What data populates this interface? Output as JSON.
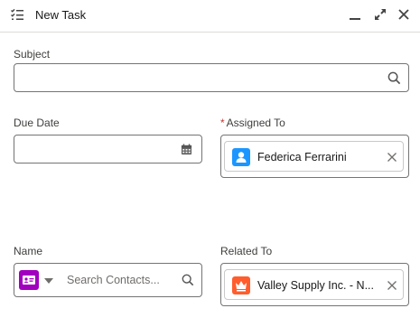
{
  "header": {
    "title": "New Task",
    "task_icon": "task-list-icon",
    "minimize_icon": "minimize-icon",
    "expand_icon": "expand-icon",
    "close_icon": "close-icon"
  },
  "form": {
    "subject": {
      "label": "Subject",
      "value": "",
      "icon": "search-icon"
    },
    "due_date": {
      "label": "Due Date",
      "value": "",
      "icon": "calendar-icon"
    },
    "assigned_to": {
      "label": "Assigned To",
      "required_marker": "*",
      "value": "Federica Ferrarini",
      "icon": "user-icon",
      "icon_color": "#1b96ff"
    },
    "name": {
      "label": "Name",
      "placeholder": "Search Contacts...",
      "object_icon": "contact-card-icon",
      "object_icon_color": "#a100bf",
      "search_icon": "search-icon"
    },
    "related_to": {
      "label": "Related To",
      "value": "Valley Supply Inc. - N...",
      "icon": "crown-icon",
      "icon_color": "#ff5d2d"
    }
  },
  "colors": {
    "border": "#747474",
    "pill_border": "#c9c9c9",
    "required": "#c23934",
    "label": "#3e3e3c"
  }
}
